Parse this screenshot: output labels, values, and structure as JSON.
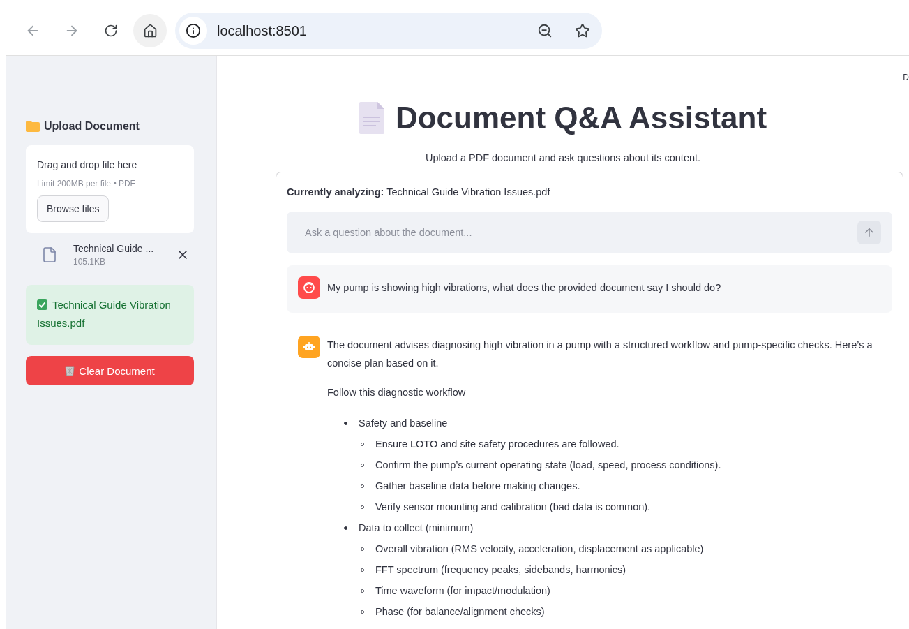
{
  "browser": {
    "url": "localhost:8501",
    "back_disabled": true,
    "forward_disabled": true
  },
  "sidebar": {
    "heading": "Upload Document",
    "dropzone": {
      "title": "Drag and drop file here",
      "hint": "Limit 200MB per file • PDF",
      "button": "Browse files"
    },
    "file": {
      "name": "Technical Guide ...",
      "size": "105.1KB"
    },
    "success": "Technical Guide Vibration Issues.pdf",
    "clear_button": "Clear Document"
  },
  "toolbar": {
    "corner_text": "D"
  },
  "main": {
    "title": "Document Q&A Assistant",
    "subtitle": "Upload a PDF document and ask questions about its content.",
    "analyzing": "**Currently analyzing:** Technical Guide Vibration Issues.pdf",
    "chat_input": {
      "placeholder": "Ask a question about the document..."
    },
    "messages": [
      {
        "kind": "user",
        "text": "My pump is showing high vibrations, what does the provided document say I should do?"
      },
      {
        "kind": "assistant",
        "paragraphs": [
          "The document advises diagnosing high vibration in a pump with a structured workflow and pump-specific checks. Here’s a concise plan based on it.",
          "Follow this diagnostic workflow"
        ],
        "list": [
          {
            "text": "Safety and baseline",
            "children": [
              {
                "text": "Ensure LOTO and site safety procedures are followed."
              },
              {
                "text": "Confirm the pump’s current operating state (load, speed, process conditions)."
              },
              {
                "text": "Gather baseline data before making changes."
              },
              {
                "text": "Verify sensor mounting and calibration (bad data is common)."
              }
            ]
          },
          {
            "text": "Data to collect (minimum)",
            "children": [
              {
                "text": "Overall vibration (RMS velocity, acceleration, displacement as applicable)"
              },
              {
                "text": "FFT spectrum (frequency peaks, sidebands, harmonics)"
              },
              {
                "text": "Time waveform (for impact/modulation)"
              },
              {
                "text": "Phase (for balance/alignment checks)"
              }
            ]
          }
        ]
      }
    ]
  }
}
